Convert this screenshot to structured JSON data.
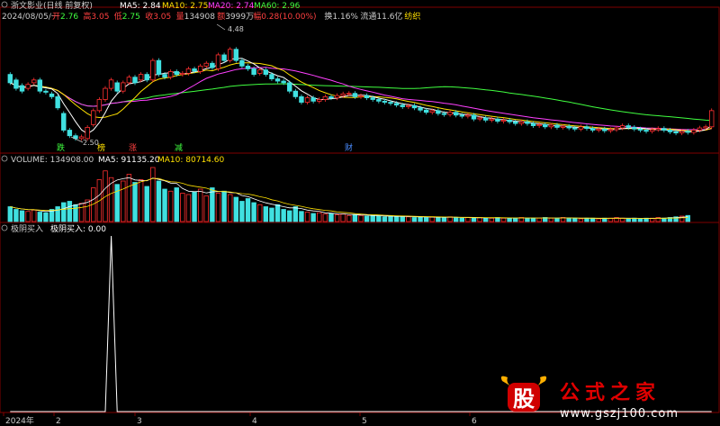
{
  "header": {
    "title": "浙文影业(日线 前复权)",
    "ma_labels": [
      {
        "text": "MA5: 2.84",
        "color": "#ffffff"
      },
      {
        "text": "MA10: 2.75",
        "color": "#ffe000"
      },
      {
        "text": "MA20: 2.74",
        "color": "#ff40ff"
      },
      {
        "text": "MA60: 2.96",
        "color": "#40ff40"
      }
    ],
    "date": "2024/08/05/一",
    "quote": [
      {
        "k": "开",
        "v": "2.76",
        "kc": "#ff4040",
        "vc": "#40ff40"
      },
      {
        "k": "高",
        "v": "3.05",
        "kc": "#ff4040",
        "vc": "#ff4040"
      },
      {
        "k": "低",
        "v": "2.75",
        "kc": "#ff4040",
        "vc": "#40ff40"
      },
      {
        "k": "收",
        "v": "3.05",
        "kc": "#ff4040",
        "vc": "#ff4040"
      },
      {
        "k": "量",
        "v": "134908",
        "kc": "#ff4040",
        "vc": "#cccccc"
      },
      {
        "k": "额",
        "v": "3999万",
        "kc": "#ff4040",
        "vc": "#cccccc"
      },
      {
        "k": "幅",
        "v": "0.28(10.00%)",
        "kc": "#ff4040",
        "vc": "#ff4040"
      },
      {
        "k": "换",
        "v": "1.16%",
        "kc": "#cccccc",
        "vc": "#cccccc"
      },
      {
        "k": "流通",
        "v": "11.6亿",
        "kc": "#cccccc",
        "vc": "#cccccc"
      },
      {
        "k": "",
        "v": "纺织",
        "kc": "#cccccc",
        "vc": "#ffe000"
      }
    ]
  },
  "price_annotations": {
    "high": "4.48",
    "low": "2.50"
  },
  "markers": [
    {
      "text": "跌",
      "color": "#40ff40"
    },
    {
      "text": "榜",
      "color": "#ffe000"
    },
    {
      "text": "涨",
      "color": "#ff4040"
    },
    {
      "text": "减",
      "color": "#40ff40"
    },
    {
      "text": "财",
      "color": "#4a8cff"
    }
  ],
  "volume_header": {
    "label": "VOLUME: 134908.00",
    "ma5": "MA5: 91135.20",
    "ma10": "MA10: 80714.60"
  },
  "indicator_header": {
    "name": "极阴买入",
    "value_label": "极阴买入: 0.00"
  },
  "x_axis": {
    "labels": [
      "2024年",
      "2",
      "3",
      "4",
      "5",
      "6"
    ]
  },
  "watermark": {
    "logo": "股",
    "brand": "公式之家",
    "url": "www.gszj100.com"
  },
  "colors": {
    "up": "#ff3030",
    "down": "#40e0e0",
    "ma5": "#ffffff",
    "ma10": "#ffe000",
    "ma20": "#ff40ff",
    "ma60": "#40ff40",
    "grid": "#800000"
  },
  "chart_data": {
    "type": "candlestick",
    "candles": [
      [
        3.7,
        3.55
      ],
      [
        3.6,
        3.45
      ],
      [
        3.5,
        3.4
      ],
      [
        3.45,
        3.52
      ],
      [
        3.55,
        3.6
      ],
      [
        3.6,
        3.4
      ],
      [
        3.4,
        3.38
      ],
      [
        3.35,
        3.3
      ],
      [
        3.3,
        3.1
      ],
      [
        3.0,
        2.7
      ],
      [
        2.7,
        2.6
      ],
      [
        2.6,
        2.55
      ],
      [
        2.55,
        2.58
      ],
      [
        2.55,
        2.75
      ],
      [
        2.8,
        3.05
      ],
      [
        3.05,
        3.25
      ],
      [
        3.25,
        3.45
      ],
      [
        3.45,
        3.6
      ],
      [
        3.55,
        3.4
      ],
      [
        3.4,
        3.55
      ],
      [
        3.55,
        3.65
      ],
      [
        3.65,
        3.55
      ],
      [
        3.6,
        3.7
      ],
      [
        3.7,
        3.6
      ],
      [
        3.6,
        3.95
      ],
      [
        3.95,
        3.7
      ],
      [
        3.7,
        3.65
      ],
      [
        3.65,
        3.75
      ],
      [
        3.75,
        3.7
      ],
      [
        3.7,
        3.72
      ],
      [
        3.72,
        3.8
      ],
      [
        3.8,
        3.76
      ],
      [
        3.75,
        3.85
      ],
      [
        3.85,
        3.9
      ],
      [
        3.9,
        3.82
      ],
      [
        3.8,
        4.05
      ],
      [
        4.05,
        3.95
      ],
      [
        3.95,
        4.15
      ],
      [
        4.15,
        3.95
      ],
      [
        3.95,
        3.85
      ],
      [
        3.85,
        3.8
      ],
      [
        3.8,
        3.7
      ],
      [
        3.72,
        3.78
      ],
      [
        3.78,
        3.7
      ],
      [
        3.7,
        3.62
      ],
      [
        3.62,
        3.58
      ],
      [
        3.58,
        3.55
      ],
      [
        3.55,
        3.4
      ],
      [
        3.4,
        3.3
      ],
      [
        3.3,
        3.2
      ],
      [
        3.2,
        3.28
      ],
      [
        3.28,
        3.22
      ],
      [
        3.22,
        3.25
      ],
      [
        3.25,
        3.3
      ],
      [
        3.3,
        3.28
      ],
      [
        3.28,
        3.32
      ],
      [
        3.32,
        3.35
      ],
      [
        3.35,
        3.36
      ],
      [
        3.36,
        3.3
      ],
      [
        3.3,
        3.32
      ],
      [
        3.32,
        3.28
      ],
      [
        3.28,
        3.25
      ],
      [
        3.25,
        3.22
      ],
      [
        3.22,
        3.2
      ],
      [
        3.2,
        3.18
      ],
      [
        3.18,
        3.15
      ],
      [
        3.15,
        3.12
      ],
      [
        3.12,
        3.14
      ],
      [
        3.14,
        3.1
      ],
      [
        3.1,
        3.06
      ],
      [
        3.06,
        3.02
      ],
      [
        3.02,
        3.05
      ],
      [
        3.05,
        3.0
      ],
      [
        3.0,
        2.98
      ],
      [
        2.98,
        3.02
      ],
      [
        3.02,
        2.97
      ],
      [
        2.97,
        2.95
      ],
      [
        2.95,
        2.97
      ],
      [
        2.97,
        2.9
      ],
      [
        2.9,
        2.92
      ],
      [
        2.92,
        2.88
      ],
      [
        2.88,
        2.9
      ],
      [
        2.9,
        2.86
      ],
      [
        2.86,
        2.88
      ],
      [
        2.88,
        2.85
      ],
      [
        2.85,
        2.82
      ],
      [
        2.82,
        2.85
      ],
      [
        2.85,
        2.82
      ],
      [
        2.82,
        2.78
      ],
      [
        2.78,
        2.8
      ],
      [
        2.8,
        2.76
      ],
      [
        2.76,
        2.79
      ],
      [
        2.79,
        2.75
      ],
      [
        2.75,
        2.77
      ],
      [
        2.77,
        2.74
      ],
      [
        2.74,
        2.72
      ],
      [
        2.72,
        2.76
      ],
      [
        2.76,
        2.73
      ],
      [
        2.73,
        2.7
      ],
      [
        2.7,
        2.72
      ],
      [
        2.72,
        2.69
      ],
      [
        2.69,
        2.71
      ],
      [
        2.71,
        2.74
      ],
      [
        2.74,
        2.78
      ],
      [
        2.78,
        2.75
      ],
      [
        2.75,
        2.72
      ],
      [
        2.72,
        2.7
      ],
      [
        2.7,
        2.68
      ],
      [
        2.68,
        2.71
      ],
      [
        2.71,
        2.73
      ],
      [
        2.73,
        2.7
      ],
      [
        2.7,
        2.67
      ],
      [
        2.67,
        2.65
      ],
      [
        2.65,
        2.68
      ],
      [
        2.68,
        2.66
      ],
      [
        2.66,
        2.7
      ],
      [
        2.7,
        2.74
      ],
      [
        2.74,
        2.76
      ],
      [
        2.76,
        3.05
      ]
    ],
    "volumes": [
      22,
      18,
      16,
      15,
      17,
      14,
      13,
      18,
      22,
      28,
      30,
      25,
      27,
      32,
      50,
      62,
      75,
      65,
      55,
      60,
      70,
      58,
      62,
      52,
      80,
      60,
      48,
      45,
      50,
      42,
      40,
      44,
      48,
      38,
      50,
      42,
      45,
      40,
      36,
      30,
      34,
      28,
      25,
      22,
      20,
      25,
      18,
      16,
      22,
      15,
      14,
      12,
      13,
      11,
      12,
      10,
      11,
      9,
      10,
      9,
      8,
      9,
      8,
      7,
      8,
      7,
      8,
      7,
      6,
      7,
      6,
      7,
      6,
      6,
      7,
      6,
      5,
      6,
      5,
      6,
      5,
      5,
      6,
      5,
      5,
      5,
      6,
      5,
      5,
      5,
      6,
      5,
      5,
      6,
      5,
      5,
      4,
      5,
      5,
      4,
      5,
      5,
      6,
      5,
      4,
      5,
      4,
      5,
      5,
      6,
      5,
      6,
      7,
      8,
      9
    ],
    "indicator_spike_index": 17,
    "ylim": [
      2.45,
      4.55
    ]
  }
}
